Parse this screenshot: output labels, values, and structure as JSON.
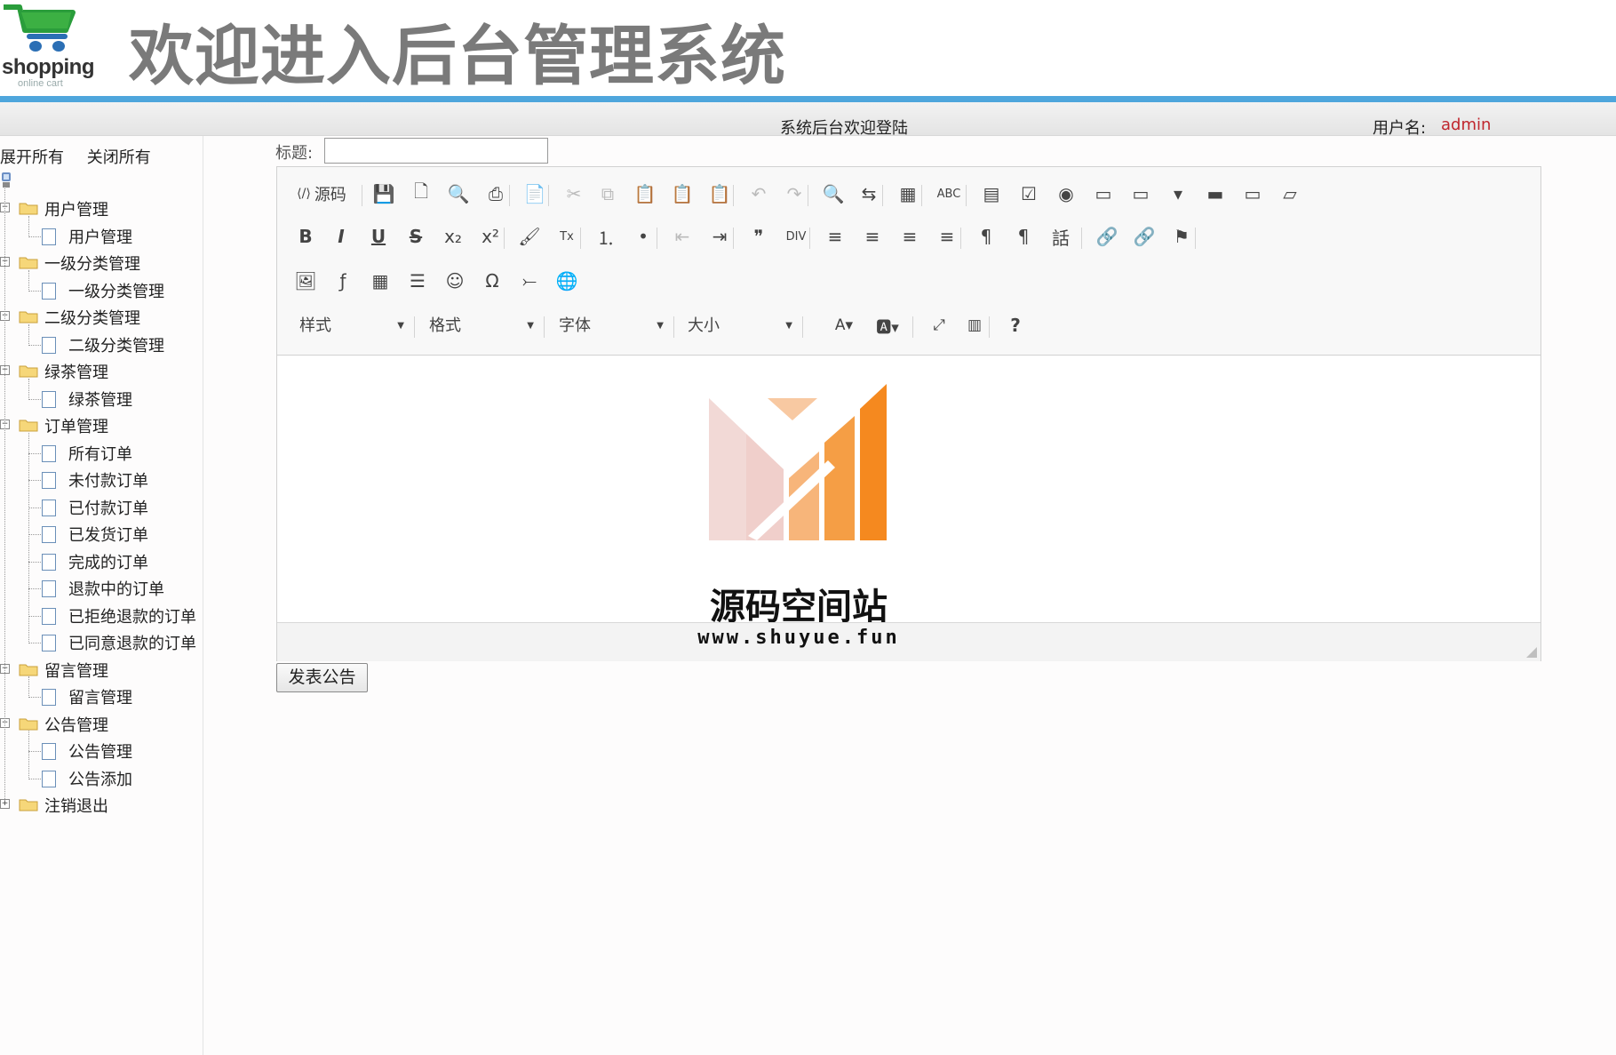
{
  "header": {
    "logo_text": "shopping",
    "logo_sub": "online cart",
    "site_title": "欢迎进入后台管理系统"
  },
  "subbar": {
    "welcome": "系统后台欢迎登陆",
    "user_label": "用户名:",
    "user_name": "admin"
  },
  "sidebar": {
    "expand_all": "展开所有",
    "collapse_all": "关闭所有",
    "groups": [
      {
        "label": "用户管理",
        "items": [
          "用户管理"
        ]
      },
      {
        "label": "一级分类管理",
        "items": [
          "一级分类管理"
        ]
      },
      {
        "label": "二级分类管理",
        "items": [
          "二级分类管理"
        ]
      },
      {
        "label": "绿茶管理",
        "items": [
          "绿茶管理"
        ]
      },
      {
        "label": "订单管理",
        "items": [
          "所有订单",
          "未付款订单",
          "已付款订单",
          "已发货订单",
          "完成的订单",
          "退款中的订单",
          "已拒绝退款的订单",
          "已同意退款的订单"
        ]
      },
      {
        "label": "留言管理",
        "items": [
          "留言管理"
        ]
      },
      {
        "label": "公告管理",
        "items": [
          "公告管理",
          "公告添加"
        ]
      },
      {
        "label": "注销退出",
        "items": []
      }
    ]
  },
  "form": {
    "title_label": "标题:",
    "title_value": "",
    "submit_label": "发表公告"
  },
  "editor": {
    "source_label": "源码",
    "combos": [
      "样式",
      "格式",
      "字体",
      "大小"
    ],
    "help": "?",
    "watermark_title": "源码空间站",
    "watermark_url": "www.shuyue.fun"
  },
  "colors": {
    "accent_bar": "#4ea6dc",
    "user_name": "#c0262d",
    "logo_orange": "#f5891f"
  }
}
